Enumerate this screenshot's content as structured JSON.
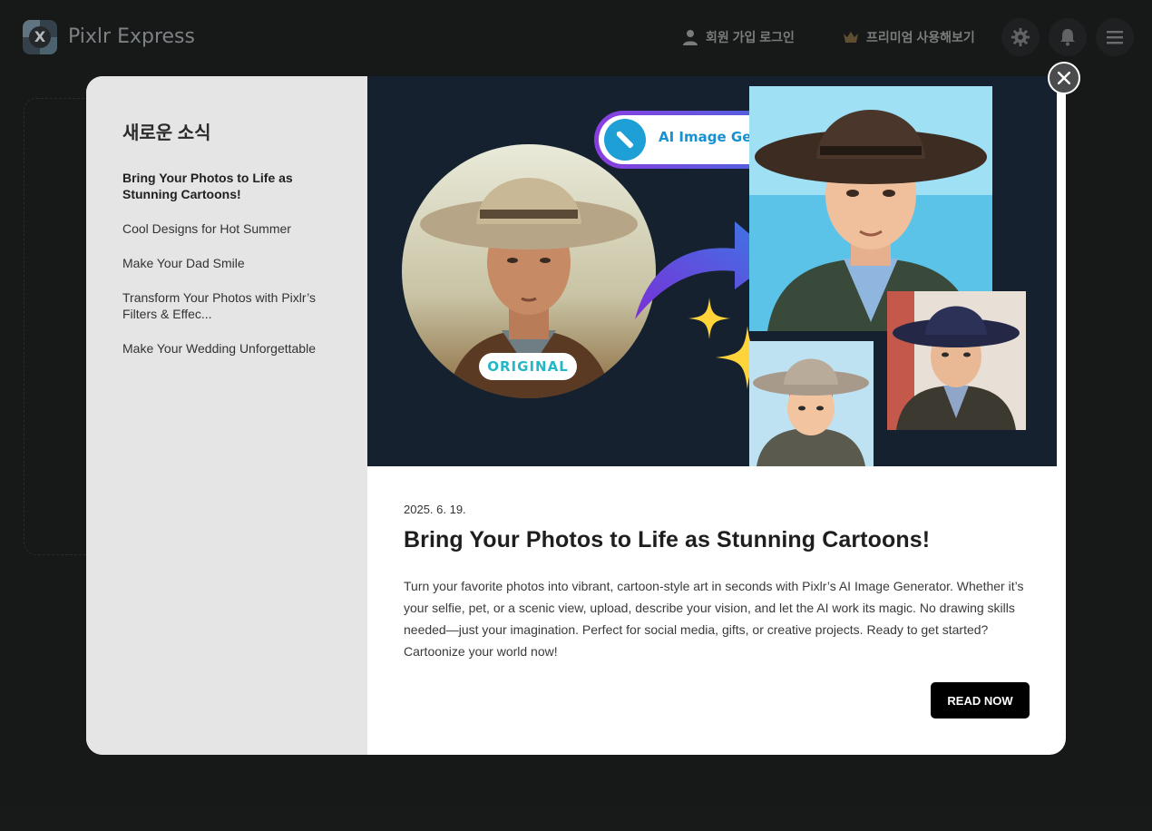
{
  "app": {
    "title": "Pixlr Express",
    "login_label": "회원 가입 로그인",
    "premium_label": "프리미엄 사용해보기",
    "icons": [
      "user-icon",
      "crown-icon",
      "gear-icon",
      "bell-icon",
      "hamburger-menu-icon"
    ]
  },
  "modal": {
    "sidebar_heading": "새로운 소식",
    "news_items": [
      {
        "label": "Bring Your Photos to Life as Stunning Cartoons!"
      },
      {
        "label": "Cool Designs for Hot Summer"
      },
      {
        "label": "Make Your Dad Smile"
      },
      {
        "label": "Transform Your Photos with Pixlr’s Filters & Effec..."
      },
      {
        "label": "Make Your Wedding Unforgettable"
      }
    ],
    "hero": {
      "badge_text": "ORIGINAL",
      "pill_text": "AI Image Generator"
    },
    "article": {
      "date": "2025. 6. 19.",
      "title": "Bring Your Photos to Life as Stunning Cartoons!",
      "body": "Turn your favorite photos into vibrant, cartoon-style art in seconds with Pixlr’s AI Image Generator. Whether it’s your selfie, pet, or a scenic view, upload, describe your vision, and let the AI work its magic. No drawing skills needed—just your imagination. Perfect for social media, gifts, or creative projects. Ready to get started? Cartoonize your world now!",
      "cta_label": "READ NOW"
    }
  },
  "colors": {
    "page_bg": "#1b1c1c",
    "sidebar_bg": "#e5e5e5",
    "hero_bg": "#15212f",
    "cta_bg": "#000000",
    "accent_blue": "#1791d0",
    "accent_purple": "#8a3ee0"
  }
}
